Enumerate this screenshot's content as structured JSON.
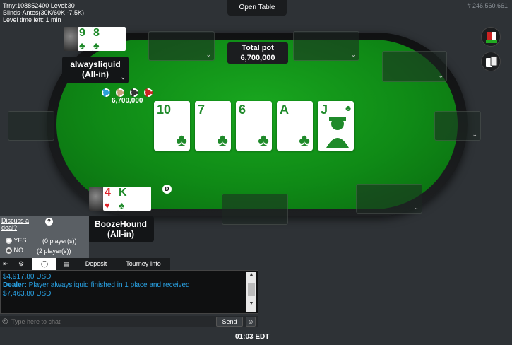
{
  "header": {
    "tourney_line": "Trny:108852400 Level:30",
    "blinds_line": "Blinds-Antes(30K/60K -7.5K)",
    "level_time_line": "Level time left: 1 min",
    "open_table_label": "Open Table",
    "table_id": "# 246,560,661"
  },
  "pot": {
    "label": "Total pot",
    "amount": "6,700,000"
  },
  "board": [
    {
      "rank": "10",
      "suit": "♣"
    },
    {
      "rank": "7",
      "suit": "♣"
    },
    {
      "rank": "6",
      "suit": "♣"
    },
    {
      "rank": "A",
      "suit": "♣"
    },
    {
      "rank": "J",
      "suit": "♣"
    }
  ],
  "players": {
    "top": {
      "name": "alwaysliquid",
      "status": "(All-in)",
      "cards": [
        {
          "rank": "9",
          "suit": "♣"
        },
        {
          "rank": "8",
          "suit": "♣"
        }
      ],
      "bet": "6,700,000"
    },
    "bottom": {
      "name": "BoozeHound",
      "status": "(All-in)",
      "cards": [
        {
          "rank": "4",
          "suit": "♥",
          "color": "#e0242a"
        },
        {
          "rank": "K",
          "suit": "♣",
          "color": "#1f8a2a"
        }
      ]
    }
  },
  "dealer_button": "D",
  "deal_panel": {
    "title_line1": "Discuss a",
    "title_line2": "deal?",
    "help_icon": "?",
    "yes_label": "YES",
    "yes_count": "(0 player(s))",
    "no_label": "NO",
    "no_count": "(2 player(s))"
  },
  "chat_tabs": {
    "deposit": "Deposit",
    "tourney_info": "Tourney Info"
  },
  "chat": {
    "lines": [
      {
        "text": "$4,917.80 USD"
      },
      {
        "speaker": "Dealer:",
        "text": " Player alwaysliquid finished in 1 place and received"
      },
      {
        "text": "$7,463.80 USD"
      }
    ],
    "placeholder": "Type here to chat",
    "send_label": "Send"
  },
  "clock": "01:03 EDT",
  "colors": {
    "felt": "#0f8a16",
    "club_green": "#1f8a2a",
    "chat_blue": "#29a3e6"
  }
}
